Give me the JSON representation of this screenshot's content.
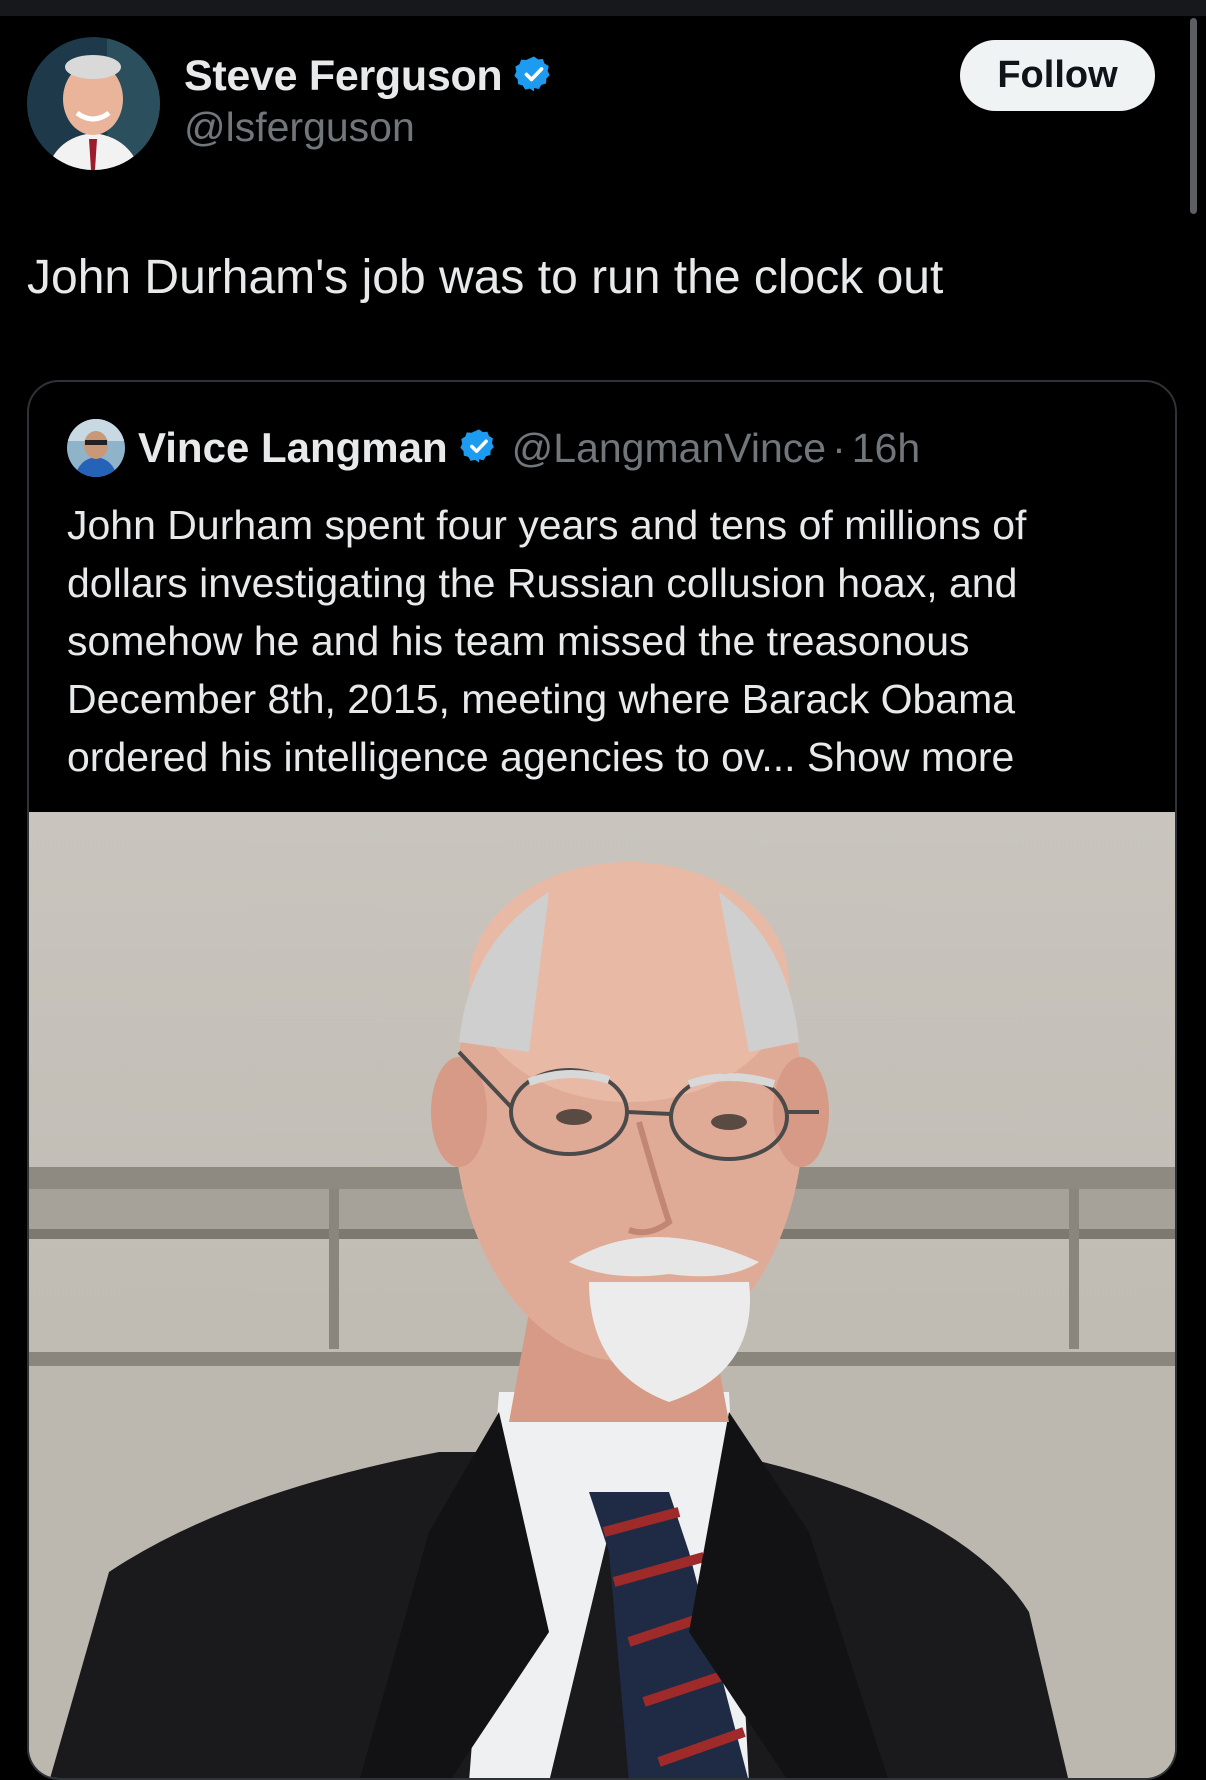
{
  "post": {
    "author_name": "Steve Ferguson",
    "author_handle": "@lsferguson",
    "follow_label": "Follow",
    "text": "John Durham's job was to run the clock out"
  },
  "quoted": {
    "author_name": "Vince Langman",
    "author_handle": "@LangmanVince",
    "separator": "·",
    "time": "16h",
    "text": "John Durham spent four years and tens of millions of dollars investigating the Russian collusion hoax, and somehow he and his team missed the treasonous December 8th, 2015, meeting where Barack Obama ordered his intelligence agencies to ov...",
    "show_more_label": "Show more"
  },
  "colors": {
    "background": "#000000",
    "text_primary": "#e7e9ea",
    "text_secondary": "#71767b",
    "verified_badge": "#1d9bf0",
    "follow_button_bg": "#eff3f4",
    "border": "#2f3336"
  },
  "icons": {
    "verified": "verified-badge-icon"
  }
}
